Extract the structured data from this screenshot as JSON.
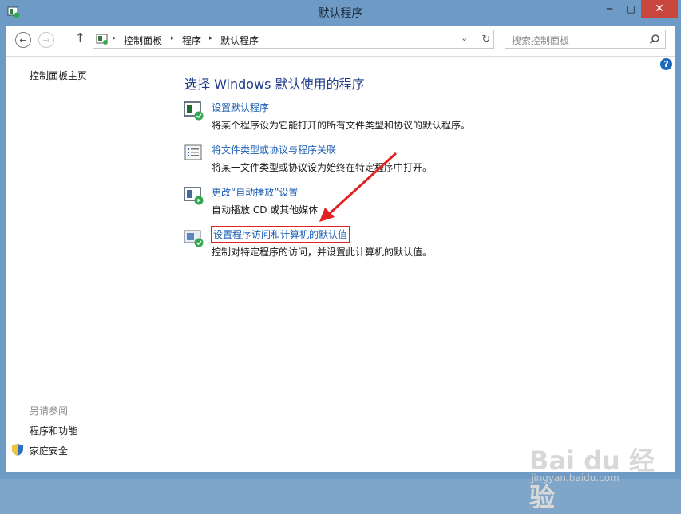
{
  "window": {
    "title": "默认程序",
    "controls": {
      "minimize": "─",
      "maximize": "□",
      "close": "✕"
    }
  },
  "navbar": {
    "back_glyph": "←",
    "forward_glyph": "→",
    "up_glyph": "↑",
    "breadcrumbs": [
      "控制面板",
      "程序",
      "默认程序"
    ],
    "separator_glyph": "▸",
    "dropdown_glyph": "⌄",
    "refresh_glyph": "↻",
    "search_placeholder": "搜索控制面板"
  },
  "help": {
    "glyph": "?"
  },
  "sidebar": {
    "home_label": "控制面板主页",
    "see_also_heading": "另请参阅",
    "links": [
      "程序和功能",
      "家庭安全"
    ]
  },
  "main": {
    "title": "选择 Windows 默认使用的程序",
    "tasks": [
      {
        "label": "设置默认程序",
        "description": "将某个程序设为它能打开的所有文件类型和协议的默认程序。",
        "icon": "default-programs-icon"
      },
      {
        "label": "将文件类型或协议与程序关联",
        "description": "将某一文件类型或协议设为始终在特定程序中打开。",
        "icon": "file-association-icon"
      },
      {
        "label": "更改“自动播放”设置",
        "description": "自动播放 CD 或其他媒体",
        "icon": "autoplay-icon"
      },
      {
        "label": "设置程序访问和计算机的默认值",
        "description": "控制对特定程序的访问，并设置此计算机的默认值。",
        "icon": "program-access-icon"
      }
    ]
  },
  "annotation": {
    "color": "#e02222"
  },
  "watermark": {
    "line1": "Bai du 经验",
    "line2": "jingyan.baidu.com"
  },
  "colors": {
    "link": "#1c5fb4",
    "title": "#1e3b8a",
    "titlebar": "#6d9bc6",
    "close": "#c9463d"
  }
}
